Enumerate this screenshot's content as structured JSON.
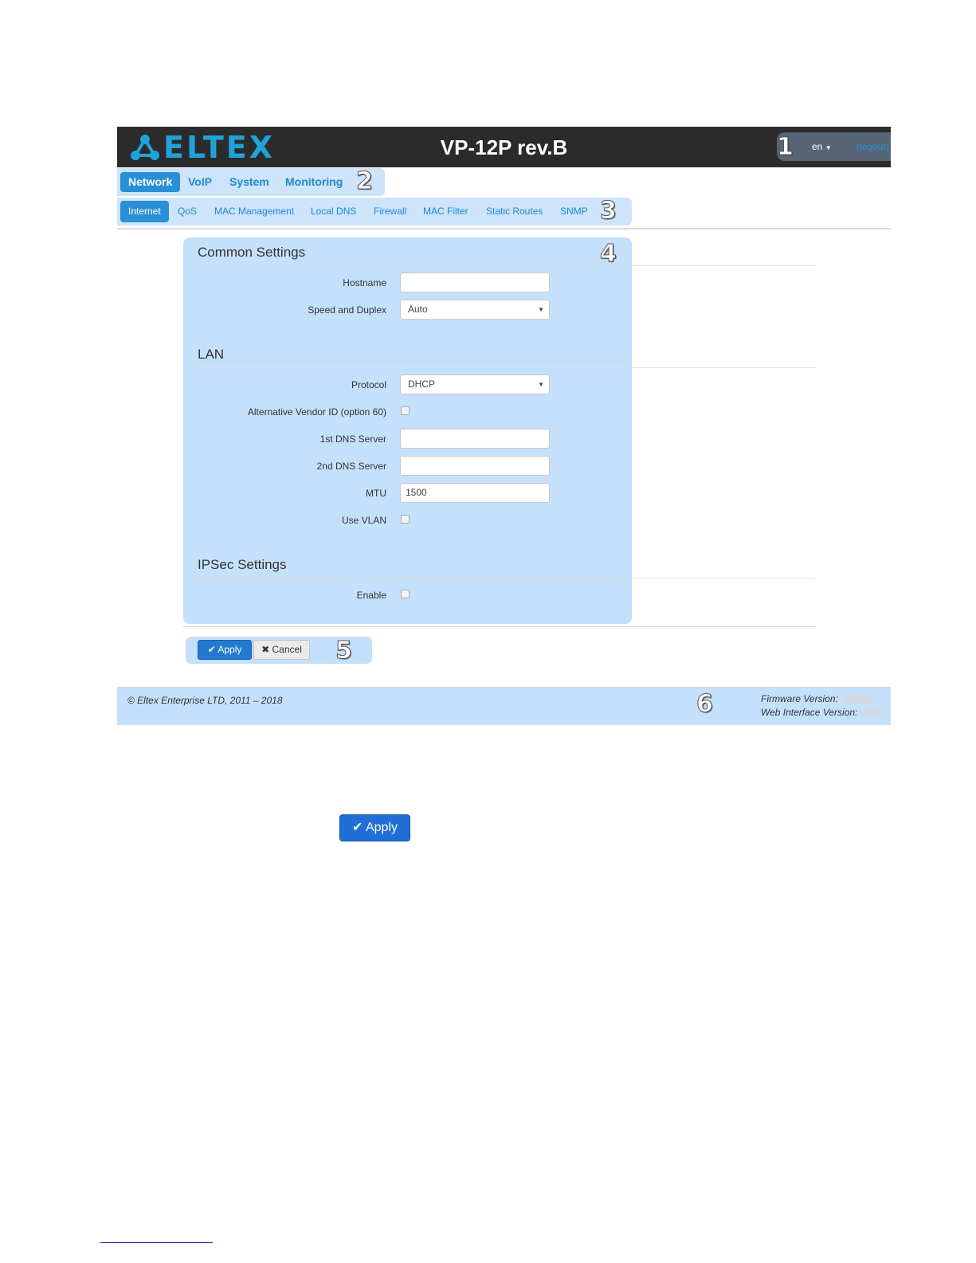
{
  "header": {
    "logo_text": "ELTEX",
    "device_title": "VP-12P rev.B",
    "language": "en",
    "logout": "(logout)"
  },
  "callouts": [
    "1",
    "2",
    "3",
    "4",
    "5",
    "6"
  ],
  "main_nav": {
    "tabs": [
      {
        "label": "Network",
        "active": true
      },
      {
        "label": "VoIP",
        "active": false
      },
      {
        "label": "System",
        "active": false
      },
      {
        "label": "Monitoring",
        "active": false
      }
    ]
  },
  "sub_nav": {
    "tabs": [
      {
        "label": "Internet",
        "active": true
      },
      {
        "label": "QoS",
        "active": false
      },
      {
        "label": "MAC Management",
        "active": false
      },
      {
        "label": "Local DNS",
        "active": false
      },
      {
        "label": "Firewall",
        "active": false
      },
      {
        "label": "MAC Filter",
        "active": false
      },
      {
        "label": "Static Routes",
        "active": false
      },
      {
        "label": "SNMP",
        "active": false
      }
    ]
  },
  "form": {
    "common": {
      "title": "Common Settings",
      "hostname_label": "Hostname",
      "hostname_value": "",
      "speed_label": "Speed and Duplex",
      "speed_value": "Auto"
    },
    "lan": {
      "title": "LAN",
      "protocol_label": "Protocol",
      "protocol_value": "DHCP",
      "vendor_id_label": "Alternative Vendor ID (option 60)",
      "vendor_id_checked": false,
      "dns1_label": "1st DNS Server",
      "dns1_value": "",
      "dns2_label": "2nd DNS Server",
      "dns2_value": "",
      "mtu_label": "MTU",
      "mtu_value": "1500",
      "vlan_label": "Use VLAN",
      "vlan_checked": false
    },
    "ipsec": {
      "title": "IPSec Settings",
      "enable_label": "Enable",
      "enable_checked": false
    }
  },
  "buttons": {
    "apply": "Apply",
    "cancel": "Cancel"
  },
  "footer": {
    "copyright": "© Eltex Enterprise LTD, 2011 – 2018",
    "firmware_label": "Firmware Version:",
    "web_label": "Web Interface Version:"
  },
  "standalone_apply": "Apply",
  "colors": {
    "brand": "#1ea3d8",
    "accent": "#2a8fd6",
    "header_bg": "#2b2b2b"
  }
}
